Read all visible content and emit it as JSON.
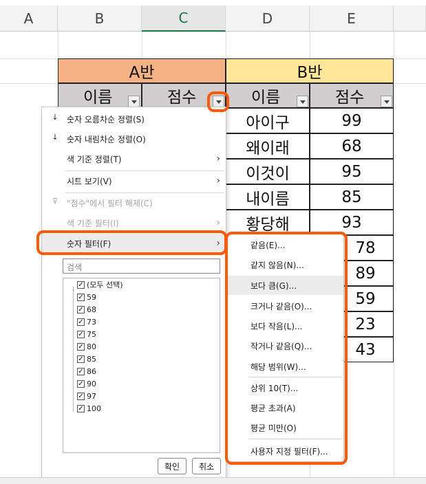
{
  "columns": [
    "A",
    "B",
    "C",
    "D",
    "E"
  ],
  "table": {
    "group_a": "A반",
    "group_b": "B반",
    "sub_headers": [
      "이름",
      "점수",
      "이름",
      "점수"
    ],
    "names_b": [
      "아이구",
      "왜이래",
      "이것이",
      "내이름",
      "황당해"
    ],
    "scores_b": [
      "99",
      "68",
      "95",
      "85",
      "93",
      "78",
      "89",
      "59",
      "23",
      "43"
    ]
  },
  "menu": {
    "sort_asc": "숫자 오름차순 정렬(S)",
    "sort_desc": "숫자 내림차순 정렬(O)",
    "sort_color": "색 기준 정렬(T)",
    "sheet_view": "시트 보기(V)",
    "clear_filter": "\"점수\"에서 필터 해제(C)",
    "color_filter": "색 기준 필터(I)",
    "number_filter": "숫자 필터(F)",
    "search_placeholder": "검색",
    "select_all": "(모두 선택)",
    "values": [
      "59",
      "68",
      "73",
      "75",
      "80",
      "85",
      "86",
      "90",
      "97",
      "100"
    ],
    "ok": "확인",
    "cancel": "취소"
  },
  "submenu": {
    "items": [
      "같음(E)...",
      "같지 않음(N)...",
      "보다 큼(G)...",
      "크거나 같음(O)...",
      "보다 작음(L)...",
      "작거나 같음(Q)...",
      "해당 범위(W)...",
      "상위 10(T)...",
      "평균 초과(A)",
      "평균 미만(O)",
      "사용자 지정 필터(F)..."
    ]
  },
  "colors": {
    "accent_orange": "#ff5a0a",
    "excel_green": "#217346",
    "header_a": "#f4b183",
    "header_b": "#ffe699"
  }
}
